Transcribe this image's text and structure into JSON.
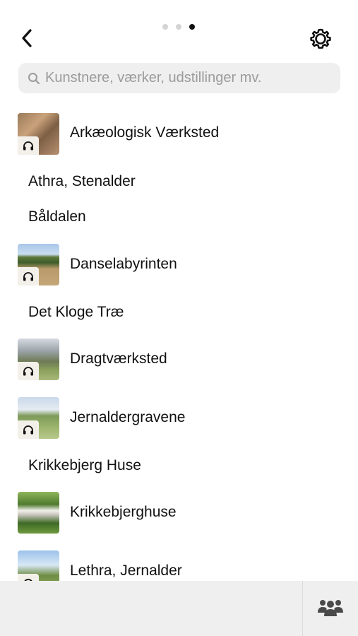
{
  "header": {
    "back_icon": "chevron-left-icon",
    "settings_icon": "gear-icon",
    "page_indicator": {
      "total": 3,
      "active": 3
    }
  },
  "search": {
    "placeholder": "Kunstnere, værker, udstillinger mv.",
    "value": "",
    "icon": "search-icon"
  },
  "list": {
    "items": [
      {
        "label": "Arkæologisk Værksted",
        "has_thumbnail": true,
        "has_audio": true
      },
      {
        "label": "Athra, Stenalder",
        "has_thumbnail": false,
        "has_audio": false
      },
      {
        "label": "Båldalen",
        "has_thumbnail": false,
        "has_audio": false
      },
      {
        "label": "Danselabyrinten",
        "has_thumbnail": true,
        "has_audio": true
      },
      {
        "label": "Det Kloge Træ",
        "has_thumbnail": false,
        "has_audio": false
      },
      {
        "label": "Dragtværksted",
        "has_thumbnail": true,
        "has_audio": true
      },
      {
        "label": "Jernaldergravene",
        "has_thumbnail": true,
        "has_audio": true
      },
      {
        "label": "Krikkebjerg Huse",
        "has_thumbnail": false,
        "has_audio": false
      },
      {
        "label": "Krikkebjerghuse",
        "has_thumbnail": true,
        "has_audio": false
      },
      {
        "label": "Lethra, Jernalder",
        "has_thumbnail": true,
        "has_audio": true
      }
    ]
  },
  "bottom_bar": {
    "people_icon": "people-group-icon"
  },
  "colors": {
    "search_background": "#efefef",
    "bottom_bar_background": "#efefef",
    "text": "#111111",
    "placeholder": "#9b9b9b",
    "dot_inactive": "#d4d4d4",
    "dot_active": "#111111"
  }
}
